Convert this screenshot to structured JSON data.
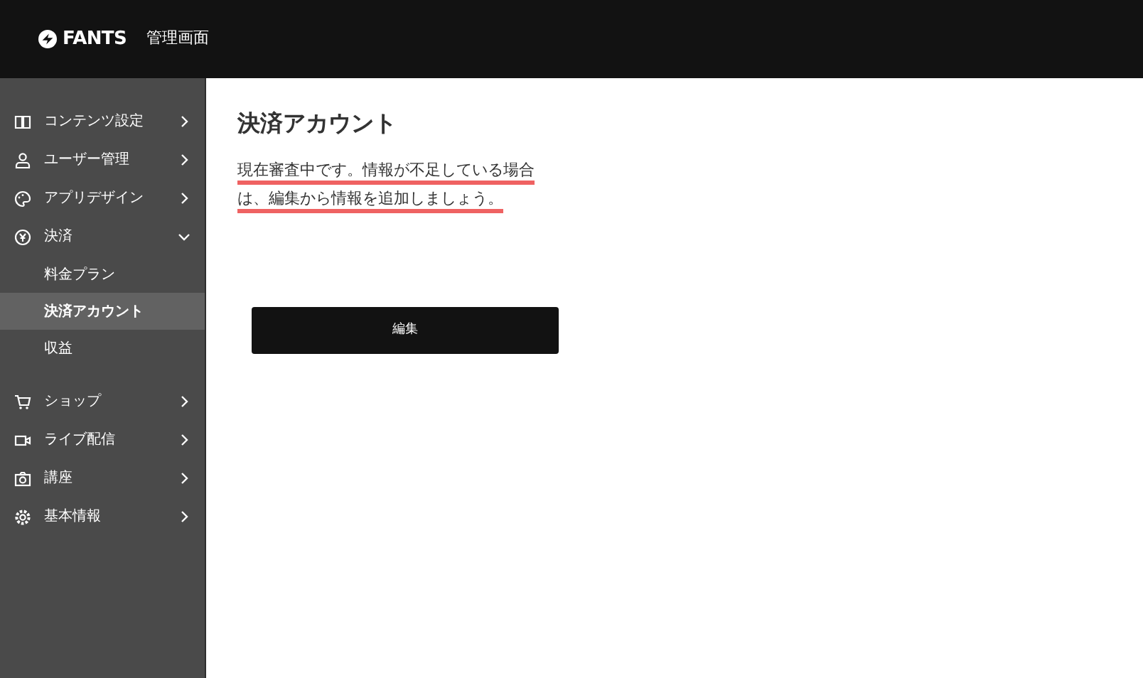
{
  "header": {
    "logo": "FANTS",
    "title": "管理画面"
  },
  "sidebar": {
    "items": [
      {
        "label": "コンテンツ設定",
        "expanded": false
      },
      {
        "label": "ユーザー管理",
        "expanded": false
      },
      {
        "label": "アプリデザイン",
        "expanded": false
      },
      {
        "label": "決済",
        "expanded": true,
        "children": [
          {
            "label": "料金プラン",
            "selected": false
          },
          {
            "label": "決済アカウント",
            "selected": true
          },
          {
            "label": "収益",
            "selected": false
          }
        ]
      },
      {
        "label": "ショップ",
        "expanded": false
      },
      {
        "label": "ライブ配信",
        "expanded": false
      },
      {
        "label": "講座",
        "expanded": false
      },
      {
        "label": "基本情報",
        "expanded": false
      }
    ]
  },
  "main": {
    "title": "決済アカウント",
    "message": "現在審査中です。情報が不足している場合は、編集から情報を追加しましょう。",
    "message_underlined": true,
    "button": "編集"
  }
}
